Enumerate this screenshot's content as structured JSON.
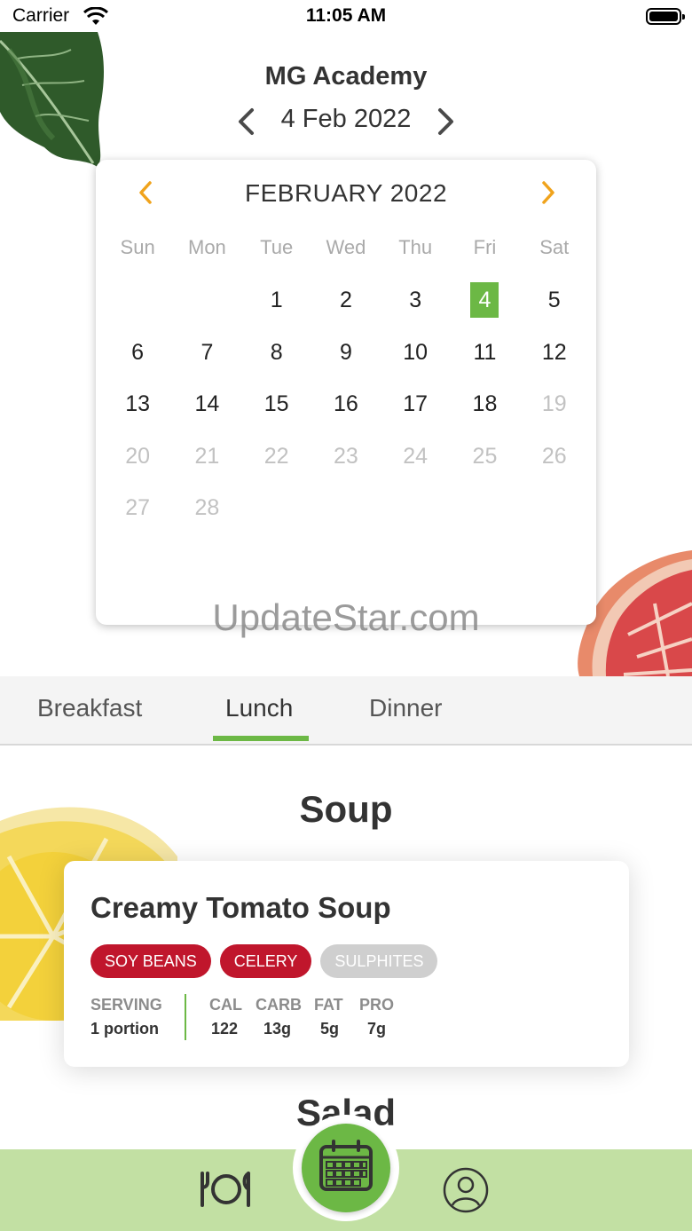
{
  "status_bar": {
    "carrier": "Carrier",
    "time": "11:05 AM"
  },
  "header": {
    "title": "MG Academy",
    "date": "4 Feb 2022"
  },
  "calendar": {
    "month_label": "FEBRUARY 2022",
    "weekdays": [
      "Sun",
      "Mon",
      "Tue",
      "Wed",
      "Thu",
      "Fri",
      "Sat"
    ],
    "leading_blanks": 2,
    "days": [
      {
        "d": "1",
        "muted": false
      },
      {
        "d": "2",
        "muted": false
      },
      {
        "d": "3",
        "muted": false
      },
      {
        "d": "4",
        "muted": false,
        "selected": true
      },
      {
        "d": "5",
        "muted": false
      },
      {
        "d": "6",
        "muted": false
      },
      {
        "d": "7",
        "muted": false
      },
      {
        "d": "8",
        "muted": false
      },
      {
        "d": "9",
        "muted": false
      },
      {
        "d": "10",
        "muted": false
      },
      {
        "d": "11",
        "muted": false
      },
      {
        "d": "12",
        "muted": false
      },
      {
        "d": "13",
        "muted": false
      },
      {
        "d": "14",
        "muted": false
      },
      {
        "d": "15",
        "muted": false
      },
      {
        "d": "16",
        "muted": false
      },
      {
        "d": "17",
        "muted": false
      },
      {
        "d": "18",
        "muted": false
      },
      {
        "d": "19",
        "muted": true
      },
      {
        "d": "20",
        "muted": true
      },
      {
        "d": "21",
        "muted": true
      },
      {
        "d": "22",
        "muted": true
      },
      {
        "d": "23",
        "muted": true
      },
      {
        "d": "24",
        "muted": true
      },
      {
        "d": "25",
        "muted": true
      },
      {
        "d": "26",
        "muted": true
      },
      {
        "d": "27",
        "muted": true
      },
      {
        "d": "28",
        "muted": true
      }
    ],
    "accent_color": "#f0a31c",
    "selected_color": "#6cb845"
  },
  "watermark": "UpdateStar.com",
  "tabs": {
    "breakfast": "Breakfast",
    "lunch": "Lunch",
    "dinner": "Dinner",
    "active": "Lunch"
  },
  "section": {
    "title": "Soup",
    "meal": {
      "name": "Creamy Tomato Soup",
      "allergens": [
        {
          "label": "SOY BEANS",
          "style": "red"
        },
        {
          "label": "CELERY",
          "style": "red"
        },
        {
          "label": "SULPHITES",
          "style": "grey"
        }
      ],
      "serving_label": "SERVING",
      "serving_value": "1 portion",
      "cal_label": "CAL",
      "cal_value": "122",
      "carb_label": "CARB",
      "carb_value": "13g",
      "fat_label": "FAT",
      "fat_value": "5g",
      "pro_label": "PRO",
      "pro_value": "7g"
    },
    "next_title": "Salad"
  },
  "colors": {
    "brand_green": "#6cb845",
    "bottom_bar": "#c2e0a3",
    "allergen_red": "#c0162c"
  },
  "bottom_nav": {
    "icons": [
      "dish-icon",
      "calendar-icon",
      "profile-icon"
    ]
  }
}
